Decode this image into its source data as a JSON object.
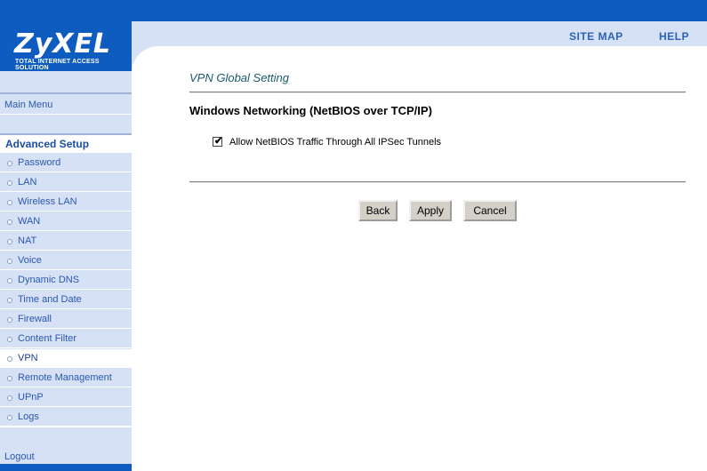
{
  "brand": {
    "logo": "ZyXEL",
    "tagline": "TOTAL INTERNET ACCESS SOLUTION",
    "accent": "#0f5cc0",
    "sidebar_bg": "#d6e1f5"
  },
  "header": {
    "site_map": "SITE MAP",
    "help": "HELP"
  },
  "sidebar": {
    "main_menu": "Main Menu",
    "advanced_setup": "Advanced Setup",
    "items": [
      {
        "label": "Password",
        "active": false
      },
      {
        "label": "LAN",
        "active": false
      },
      {
        "label": "Wireless LAN",
        "active": false
      },
      {
        "label": "WAN",
        "active": false
      },
      {
        "label": "NAT",
        "active": false
      },
      {
        "label": "Voice",
        "active": false
      },
      {
        "label": "Dynamic DNS",
        "active": false
      },
      {
        "label": "Time and Date",
        "active": false
      },
      {
        "label": "Firewall",
        "active": false
      },
      {
        "label": "Content Filter",
        "active": false
      },
      {
        "label": "VPN",
        "active": true
      },
      {
        "label": "Remote Management",
        "active": false
      },
      {
        "label": "UPnP",
        "active": false
      },
      {
        "label": "Logs",
        "active": false
      }
    ],
    "logout": "Logout"
  },
  "main": {
    "page_title": "VPN Global Setting",
    "section_title": "Windows Networking (NetBIOS over TCP/IP)",
    "checkbox": {
      "label": "Allow NetBIOS Traffic Through All IPSec Tunnels",
      "checked": true
    },
    "buttons": {
      "back": "Back",
      "apply": "Apply",
      "cancel": "Cancel"
    }
  }
}
